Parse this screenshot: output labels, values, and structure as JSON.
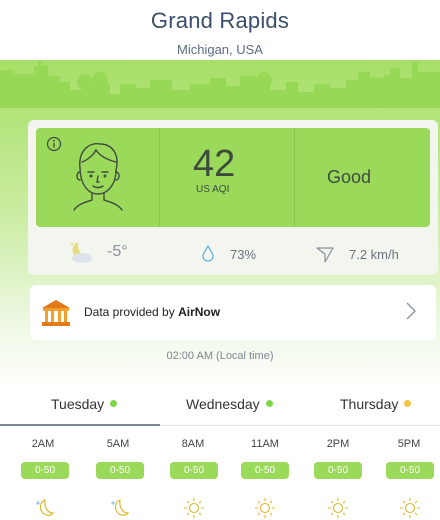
{
  "location": {
    "city": "Grand Rapids",
    "region": "Michigan, USA"
  },
  "aqi": {
    "value": "42",
    "unit": "US AQI",
    "level": "Good",
    "color": "#9bd95b"
  },
  "stats": {
    "temperature": "-5°",
    "humidity": "73%",
    "wind": "7.2 km/h"
  },
  "provider": {
    "prefix": "Data provided by ",
    "name": "AirNow"
  },
  "local_time": "02:00 AM (Local time)",
  "days": [
    {
      "label": "Tuesday",
      "dot_color": "#7fd64a"
    },
    {
      "label": "Wednesday",
      "dot_color": "#7fd64a"
    },
    {
      "label": "Thursday",
      "dot_color": "#f4c542"
    }
  ],
  "hours": [
    {
      "time": "2AM",
      "range": "0-50",
      "icon": "moon-star-icon"
    },
    {
      "time": "5AM",
      "range": "0-50",
      "icon": "moon-star-icon"
    },
    {
      "time": "8AM",
      "range": "0-50",
      "icon": "sun-icon"
    },
    {
      "time": "11AM",
      "range": "0-50",
      "icon": "sun-icon"
    },
    {
      "time": "2PM",
      "range": "0-50",
      "icon": "sun-icon"
    },
    {
      "time": "5PM",
      "range": "0-50",
      "icon": "sun-icon"
    }
  ],
  "icons": {
    "info": "info-icon",
    "face": "face-icon",
    "night": "moon-cloud-icon",
    "humidity": "droplet-icon",
    "wind": "wind-direction-icon",
    "provider": "building-icon",
    "chevron": "chevron-right-icon"
  }
}
